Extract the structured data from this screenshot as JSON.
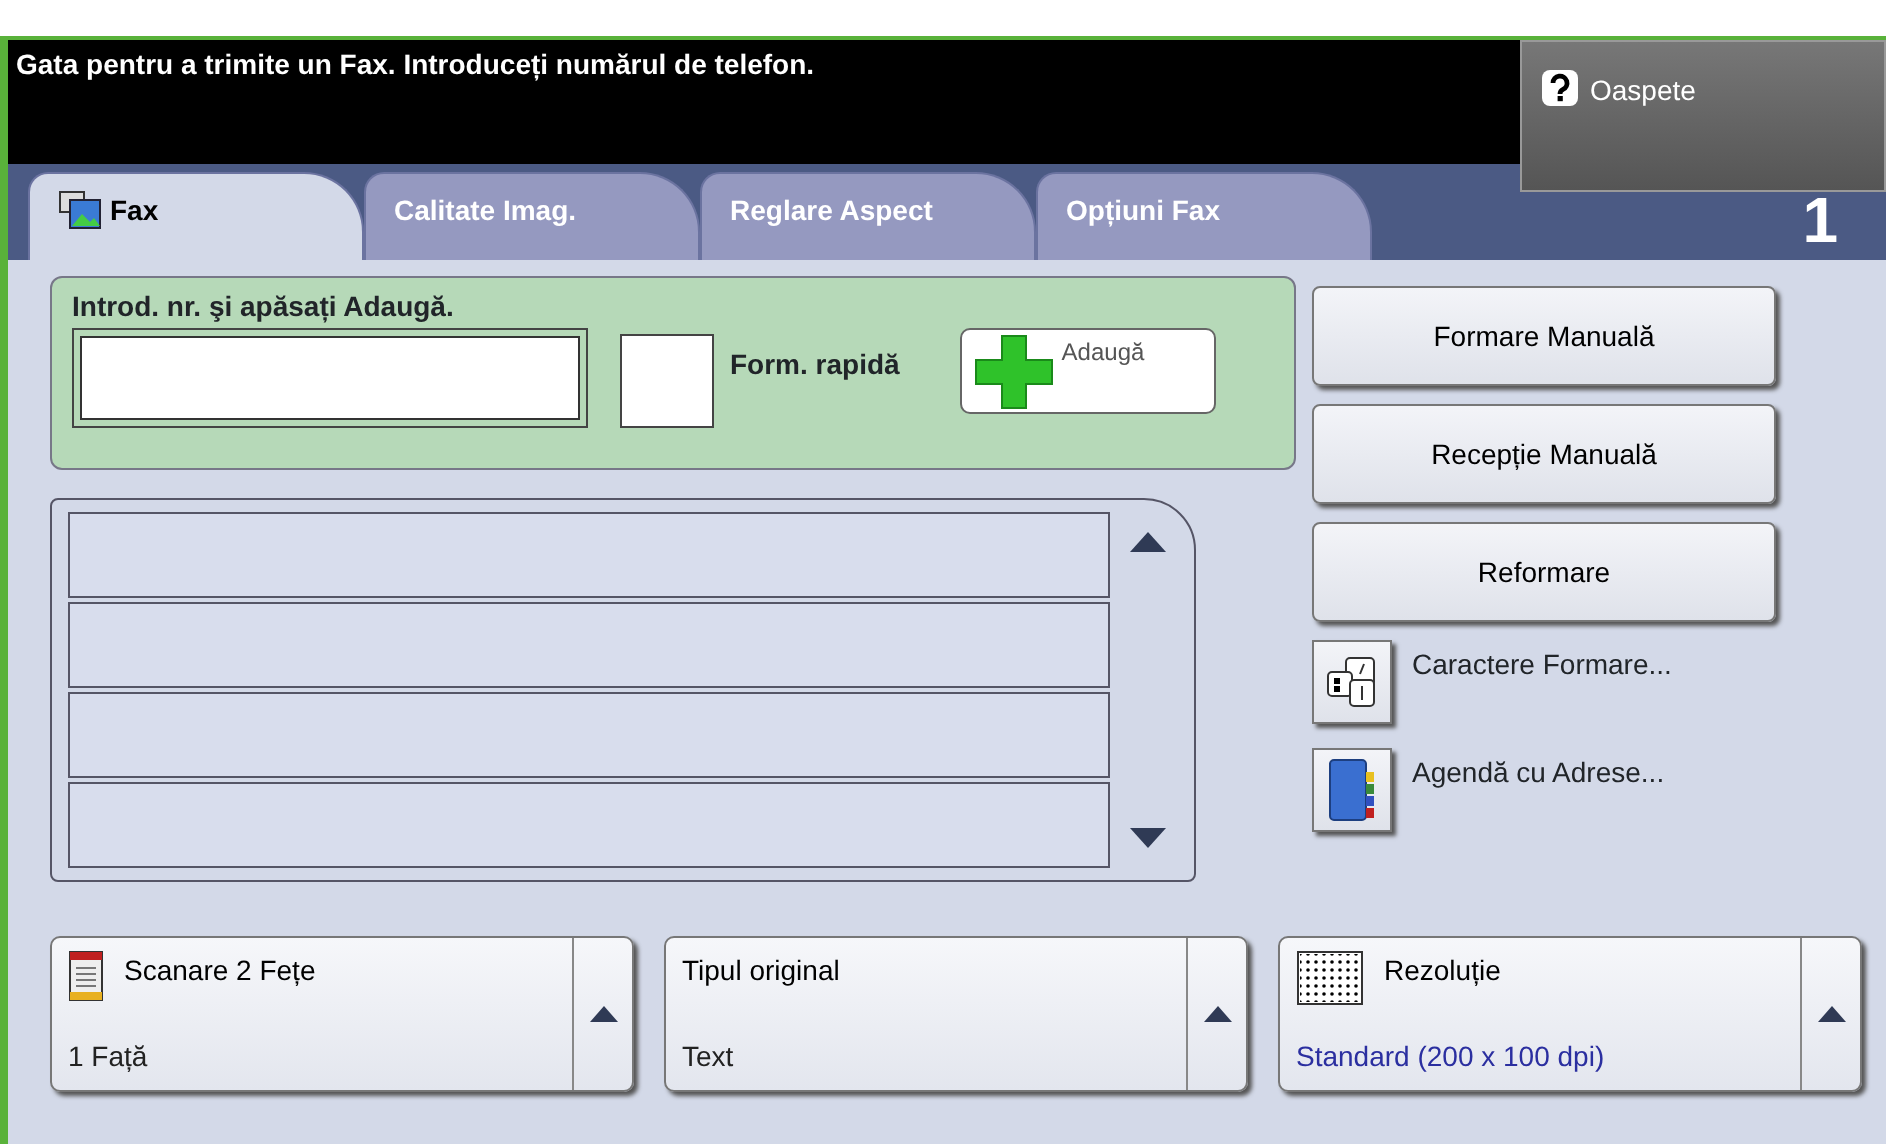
{
  "status": {
    "message": "Gata pentru a trimite un Fax. Introduceți numărul de telefon."
  },
  "guest_button": {
    "label": "Oaspete"
  },
  "tabs": [
    {
      "label": "Fax",
      "selected": true,
      "kind": "icon"
    },
    {
      "label": "Calitate Imag.",
      "selected": false,
      "kind": "plain"
    },
    {
      "label": "Reglare Aspect",
      "selected": false,
      "kind": "plain"
    },
    {
      "label": "Opțiuni Fax",
      "selected": false,
      "kind": "plain"
    }
  ],
  "counter": "1",
  "entry": {
    "label": "Introd. nr. şi apăsați Adaugă.",
    "speed_dial_label": "Form. rapidă",
    "add_button": "Adaugă"
  },
  "dial_buttons": [
    "Formare Manuală",
    "Recepție Manuală",
    "Reformare"
  ],
  "side_actions": [
    {
      "kind": "dial-characters",
      "label": "Caractere Formare..."
    },
    {
      "kind": "address-book",
      "label": "Agendă cu Adrese..."
    }
  ],
  "features": [
    {
      "kind": "two-sided",
      "title": "Scanare 2 Fețe",
      "value": "1 Față",
      "color": "#222222"
    },
    {
      "kind": "none",
      "title": "Tipul original",
      "value": "Text",
      "color": "#222222"
    },
    {
      "kind": "resolution",
      "title": "Rezoluție",
      "value": "Standard (200 x 100 dpi)",
      "color": "#2b2fa0"
    }
  ]
}
